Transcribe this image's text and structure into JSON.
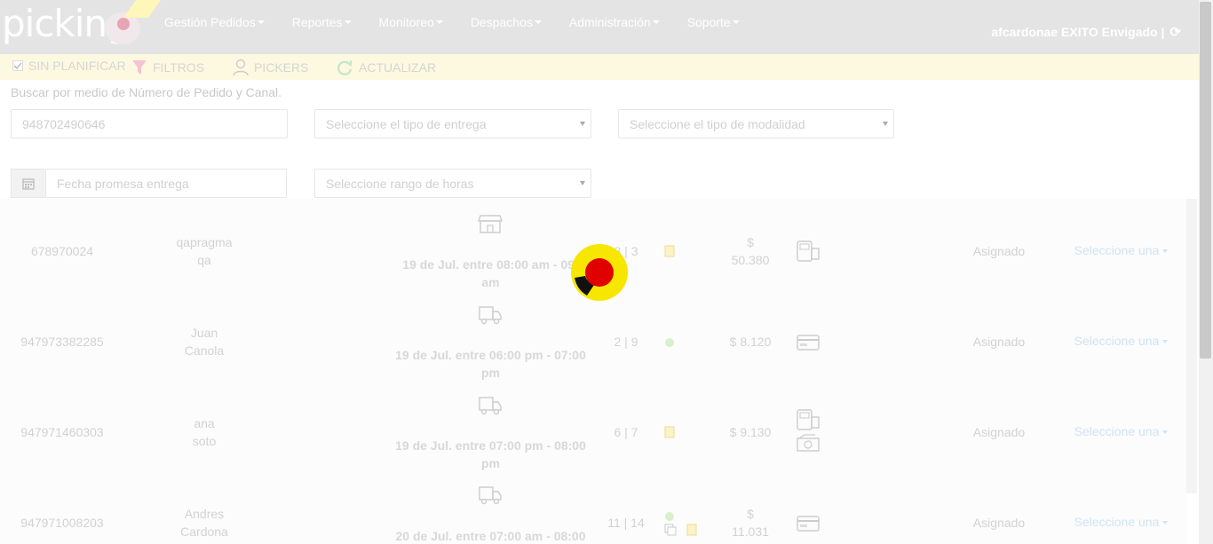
{
  "brand": {
    "logo_text": "picking"
  },
  "nav": {
    "items": [
      {
        "label": "Gestión Pedidos"
      },
      {
        "label": "Reportes"
      },
      {
        "label": "Monitoreo"
      },
      {
        "label": "Despachos"
      },
      {
        "label": "Administración"
      },
      {
        "label": "Soporte"
      }
    ],
    "user_label": "afcardonae EXITO Envigado |"
  },
  "toolbar": {
    "unplanned": "SIN PLANIFICAR",
    "filters": "FILTROS",
    "pickers": "PICKERS",
    "update": "ACTUALIZAR"
  },
  "search": {
    "hint": "Buscar por medio de Número de Pedido y Canal.",
    "order_value": "948702490646",
    "delivery_type_placeholder": "Seleccione el tipo de entrega",
    "modality_placeholder": "Seleccione el tipo de modalidad",
    "date_placeholder": "Fecha promesa entrega",
    "hours_placeholder": "Seleccione rango de horas"
  },
  "orders": [
    {
      "id": "678970024",
      "name1": "qapragma",
      "name2": "qa",
      "delivery1": "19 de Jul. entre 08:00 am - 09:",
      "delivery2": "am",
      "counts": "3 | 3",
      "price1": "$",
      "price2": "50.380",
      "status": "Asignado",
      "select": "Seleccione una",
      "delivery_icon": "store-icon"
    },
    {
      "id": "947973382285",
      "name1": "Juan",
      "name2": "Canola",
      "delivery1": "19 de Jul. entre 06:00 pm - 07:00",
      "delivery2": "pm",
      "counts": "2 | 9",
      "price1": "$ 8.120",
      "price2": "",
      "status": "Asignado",
      "select": "Seleccione una",
      "delivery_icon": "truck-icon"
    },
    {
      "id": "947971460303",
      "name1": "ana",
      "name2": "soto",
      "delivery1": "19 de Jul. entre 07:00 pm - 08:00",
      "delivery2": "pm",
      "counts": "6 | 7",
      "price1": "$ 9.130",
      "price2": "",
      "status": "Asignado",
      "select": "Seleccione una",
      "delivery_icon": "truck-icon"
    },
    {
      "id": "947971008203",
      "name1": "Andres",
      "name2": "Cardona",
      "delivery1": "20 de Jul. entre 07:00 am - 08:00",
      "delivery2": "",
      "counts": "11 | 14",
      "price1": "$",
      "price2": "11.031",
      "status": "Asignado",
      "select": "Seleccione una",
      "delivery_icon": "truck-icon"
    }
  ],
  "colors": {
    "navbar": "#e4e4e4",
    "toolbar": "#fdf9e0",
    "spinner_outer": "#f7e600",
    "spinner_inner": "#e00000"
  }
}
